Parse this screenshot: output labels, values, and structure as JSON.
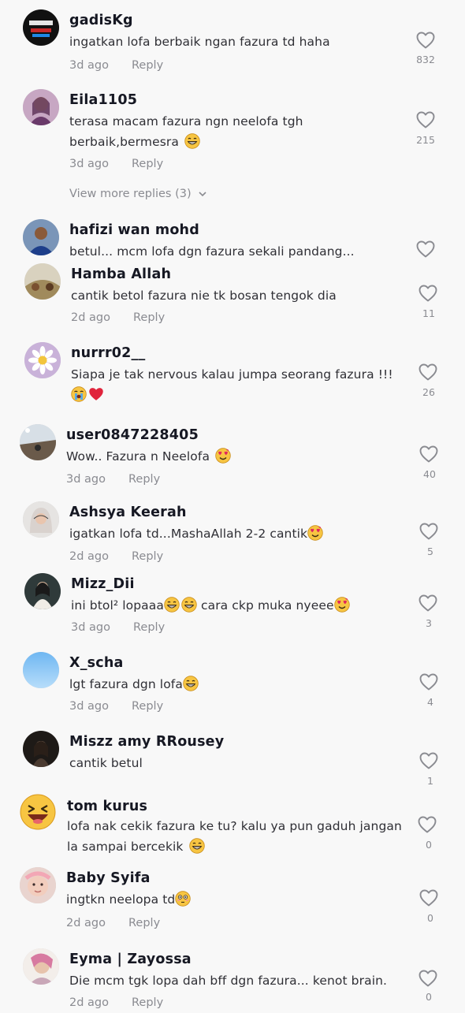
{
  "comments": [
    {
      "username": "gadisKg",
      "text": "ingatkan lofa berbaik ngan fazura td haha",
      "time": "3d ago",
      "reply": "Reply",
      "likes": "832"
    },
    {
      "username": "Eila1105",
      "text": "terasa macam fazura ngn neelofa tgh berbaik,bermesra",
      "time": "3d ago",
      "reply": "Reply",
      "likes": "215"
    },
    {
      "username": "hafizi wan mohd",
      "text": "betul... mcm lofa dgn fazura sekali pandang...",
      "time": "",
      "reply": "",
      "likes": ""
    },
    {
      "username": "Hamba Allah",
      "text": "cantik betol fazura nie tk bosan tengok dia",
      "time": "2d ago",
      "reply": "Reply",
      "likes": "11"
    },
    {
      "username": "nurrr02__",
      "text": "Siapa je tak nervous kalau jumpa seorang fazura !!!",
      "time": "",
      "reply": "",
      "likes": "26"
    },
    {
      "username": "user0847228405",
      "text": "Wow.. Fazura n Neelofa",
      "time": "3d ago",
      "reply": "Reply",
      "likes": "40"
    },
    {
      "username": "Ashsya Keerah",
      "text": "igatkan lofa td...MashaAllah 2-2 cantik",
      "time": "2d ago",
      "reply": "Reply",
      "likes": "5"
    },
    {
      "username": "Mizz_Dii",
      "text": "ini btol² lopaaa",
      "text2": "cara ckp muka nyeee",
      "time": "3d ago",
      "reply": "Reply",
      "likes": "3"
    },
    {
      "username": "X_scha",
      "text": "lgt fazura dgn lofa",
      "time": "3d ago",
      "reply": "Reply",
      "likes": "4"
    },
    {
      "username": "Miszz amy RRousey",
      "text": "cantik betul",
      "time": "",
      "reply": "",
      "likes": "1"
    },
    {
      "username": "tom kurus",
      "text": "lofa nak cekik fazura ke tu? kalu ya pun gaduh jangan la sampai bercekik",
      "time": "",
      "reply": "",
      "likes": "0"
    },
    {
      "username": "Baby Syifa",
      "text": "ingtkn neelopa td",
      "time": "2d ago",
      "reply": "Reply",
      "likes": "0"
    },
    {
      "username": "Eyma | Zayossa",
      "text": "Die mcm tgk lopa dah bff dgn fazura... kenot brain.",
      "time": "2d ago",
      "reply": "Reply",
      "likes": "0"
    }
  ],
  "view_more_replies": "View more replies (3)",
  "colors": {
    "background": "#f8f8f8",
    "username": "#161823",
    "text": "#2f2f35",
    "meta": "#8a8b91",
    "heart_outline": "#8a8b91"
  }
}
